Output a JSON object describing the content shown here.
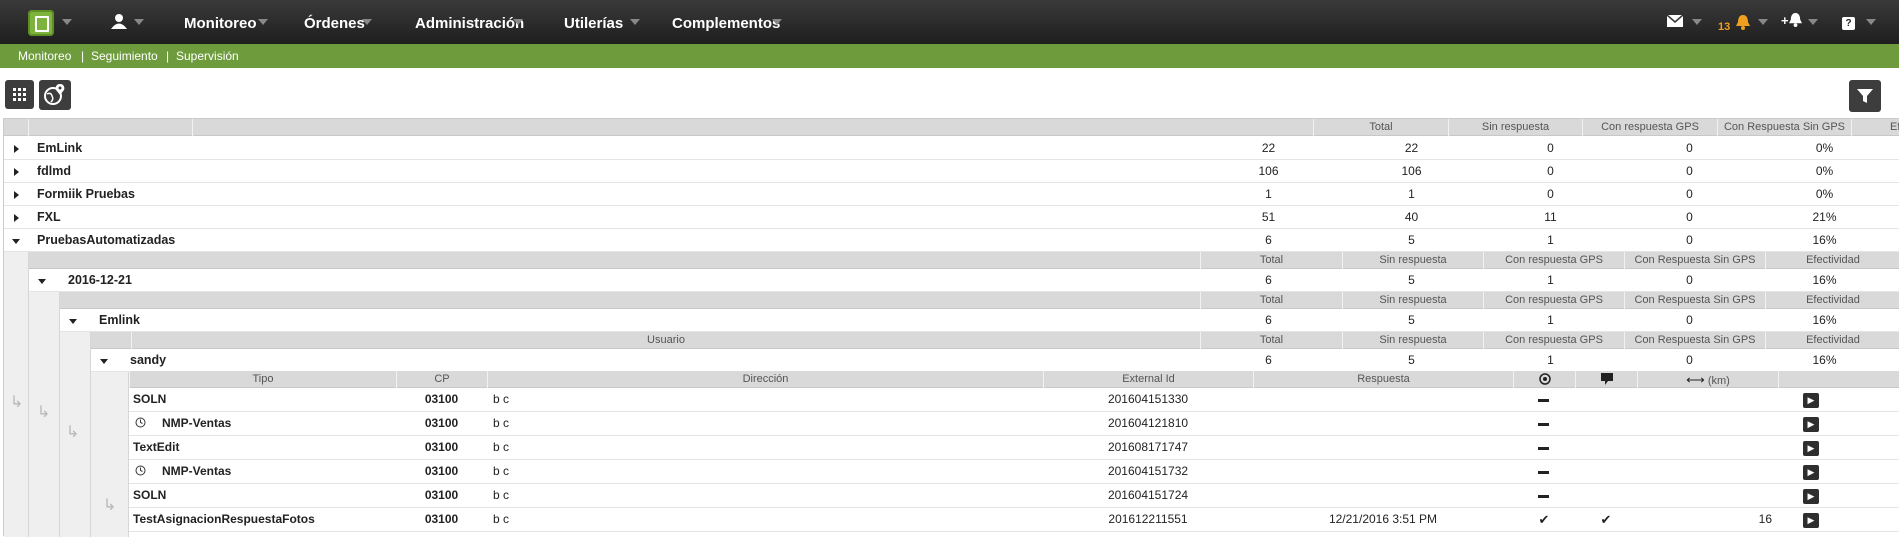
{
  "topnav": {
    "menu": [
      "Monitoreo",
      "Órdenes",
      "Administración",
      "Utilerías",
      "Complementos"
    ],
    "notification_count": "13"
  },
  "subnav": {
    "links": [
      "Monitoreo",
      "Seguimiento",
      "Supervisión"
    ],
    "separator": "|"
  },
  "grid": {
    "top_headers": [
      "Total",
      "Sin respuesta",
      "Con respuesta GPS",
      "Con Respuesta Sin GPS",
      "Ef"
    ],
    "headers": [
      "Total",
      "Sin respuesta",
      "Con respuesta GPS",
      "Con Respuesta Sin GPS",
      "Efectividad"
    ],
    "usuario_header": "Usuario",
    "groups": [
      {
        "name": "EmLink",
        "values": [
          "22",
          "22",
          "0",
          "0",
          "0%"
        ]
      },
      {
        "name": "fdlmd",
        "values": [
          "106",
          "106",
          "0",
          "0",
          "0%"
        ]
      },
      {
        "name": "Formiik Pruebas",
        "values": [
          "1",
          "1",
          "0",
          "0",
          "0%"
        ]
      },
      {
        "name": "FXL",
        "values": [
          "51",
          "40",
          "11",
          "0",
          "21%"
        ]
      },
      {
        "name": "PruebasAutomatizadas",
        "values": [
          "6",
          "5",
          "1",
          "0",
          "16%"
        ]
      }
    ],
    "date_row": {
      "name": "2016-12-21",
      "values": [
        "6",
        "5",
        "1",
        "0",
        "16%"
      ]
    },
    "company_row": {
      "name": "Emlink",
      "values": [
        "6",
        "5",
        "1",
        "0",
        "16%"
      ]
    },
    "user_row": {
      "name": "sandy",
      "values": [
        "6",
        "5",
        "1",
        "0",
        "16%"
      ]
    },
    "detail_headers": {
      "tipo": "Tipo",
      "cp": "CP",
      "direccion": "Dirección",
      "external_id": "External Id",
      "respuesta": "Respuesta",
      "distance": "(km)"
    },
    "detail_rows": [
      {
        "tipo": "SOLN",
        "cp": "03100",
        "direccion": "b c",
        "external_id": "201604151330",
        "respuesta": "",
        "distance": ""
      },
      {
        "tipo": "NMP-Ventas",
        "cp": "03100",
        "direccion": "b c",
        "external_id": "201604121810",
        "respuesta": "",
        "distance": ""
      },
      {
        "tipo": "TextEdit",
        "cp": "03100",
        "direccion": "b c",
        "external_id": "201608171747",
        "respuesta": "",
        "distance": ""
      },
      {
        "tipo": "NMP-Ventas",
        "cp": "03100",
        "direccion": "b c",
        "external_id": "201604151732",
        "respuesta": "",
        "distance": ""
      },
      {
        "tipo": "SOLN",
        "cp": "03100",
        "direccion": "b c",
        "external_id": "201604151724",
        "respuesta": "",
        "distance": ""
      },
      {
        "tipo": "TestAsignacionRespuestaFotos",
        "cp": "03100",
        "direccion": "b c",
        "external_id": "201612211551",
        "respuesta": "12/21/2016 3:51 PM",
        "distance": "16"
      }
    ]
  }
}
